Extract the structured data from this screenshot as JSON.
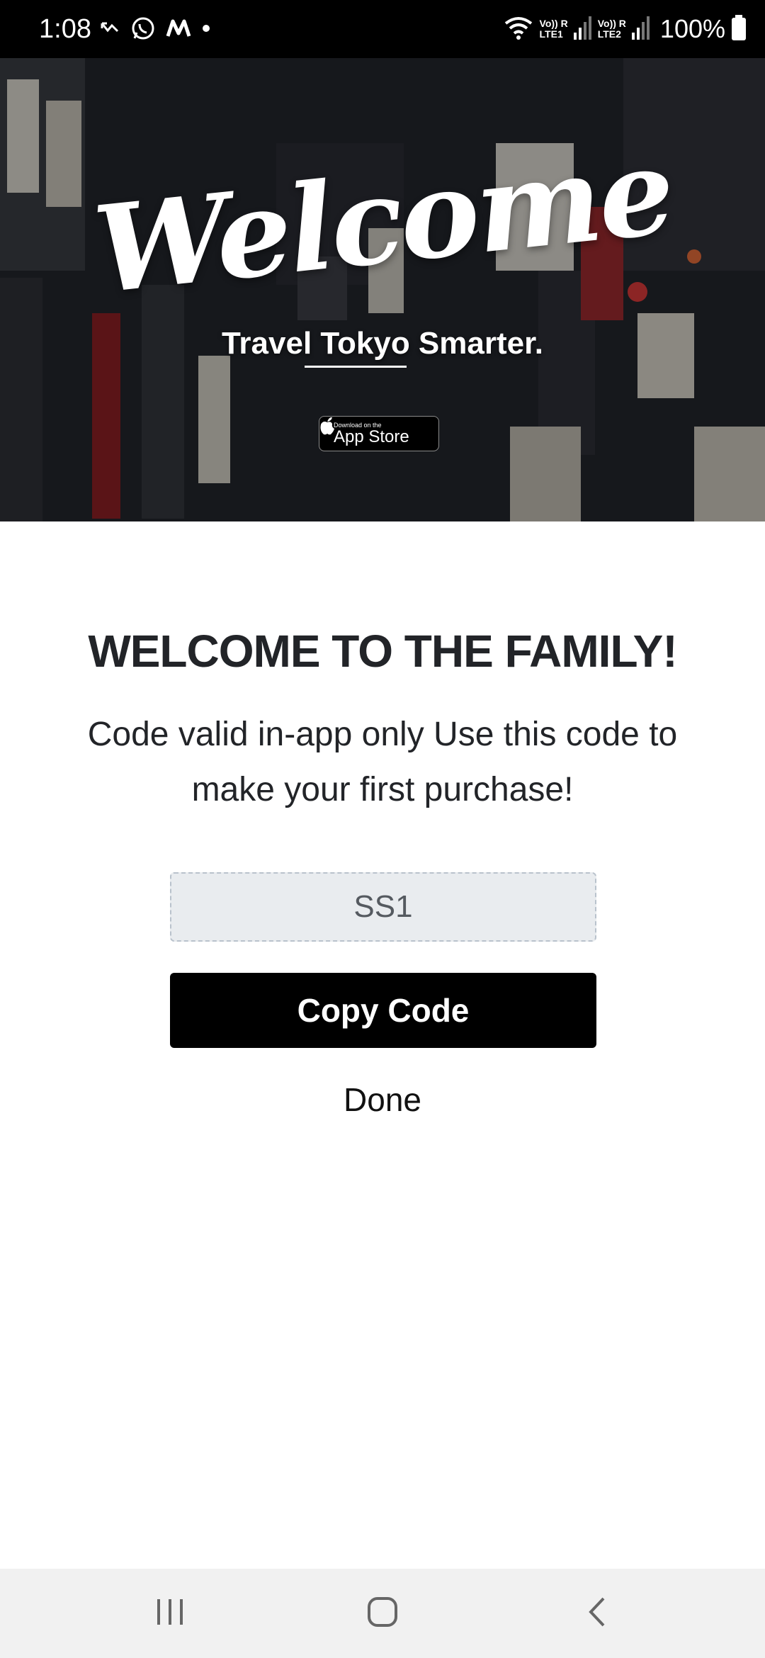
{
  "status_bar": {
    "time": "1:08",
    "battery": "100%",
    "sim1_label": "Vo)) R\nLTE1",
    "sim2_label": "Vo)) R\nLTE2",
    "icons": [
      "missed-call-icon",
      "whatsapp-icon",
      "m-app-icon",
      "dot-icon",
      "wifi-icon",
      "signal-icon",
      "battery-icon"
    ]
  },
  "hero": {
    "title": "Welcome",
    "tagline": "Travel Tokyo Smarter.",
    "badge_small": "Download on the",
    "badge_big": "App Store"
  },
  "content": {
    "heading": "WELCOME TO THE FAMILY!",
    "description": "Code valid in-app only Use this code to make your first purchase!",
    "code": "SS1",
    "copy_button": "Copy Code",
    "done_link": "Done"
  },
  "nav_bar": {
    "icons": [
      "recent-apps-icon",
      "home-icon",
      "back-icon"
    ]
  },
  "colors": {
    "status_bar_bg": "#000000",
    "heading_text": "#222428",
    "code_box_bg": "#e9ecef",
    "button_bg": "#000000",
    "nav_bar_bg": "#f1f1f1"
  }
}
